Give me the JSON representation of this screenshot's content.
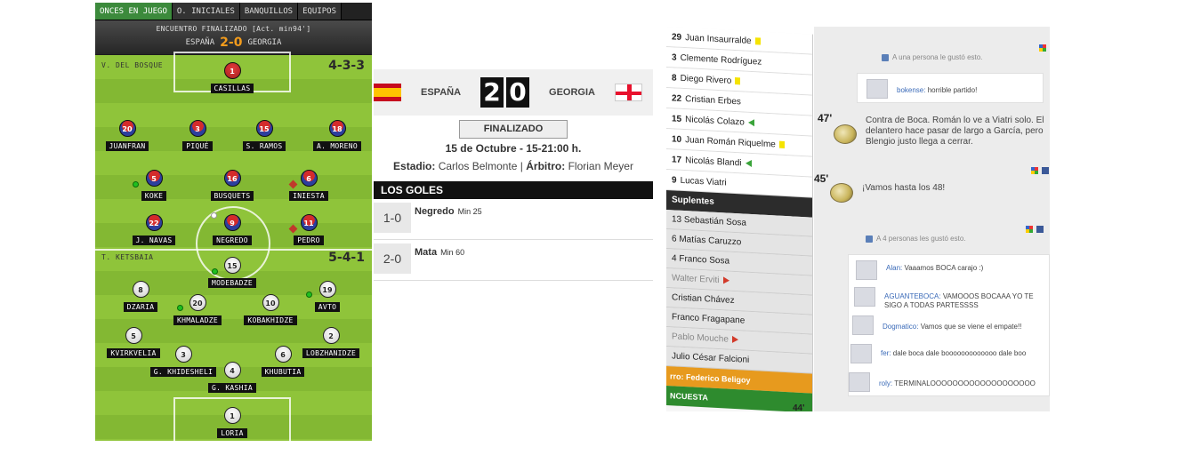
{
  "tabs": [
    "ONCES EN JUEGO",
    "O. INICIALES",
    "BANQUILLOS",
    "EQUIPOS"
  ],
  "match_header": {
    "status": "ENCUENTRO FINALIZADO [Act. min94']",
    "home": "ESPAÑA",
    "score": "2-0",
    "away": "GEORGIA"
  },
  "pitch": {
    "home_coach": "V. DEL BOSQUE",
    "home_formation": "4-3-3",
    "away_coach": "T. KETSBAIA",
    "away_formation": "5-4-1",
    "home_players": [
      {
        "num": "1",
        "name": "CASILLAS"
      },
      {
        "num": "20",
        "name": "JUANFRAN"
      },
      {
        "num": "3",
        "name": "PIQUÉ"
      },
      {
        "num": "15",
        "name": "S. RAMOS"
      },
      {
        "num": "18",
        "name": "A. MORENO"
      },
      {
        "num": "5",
        "name": "KOKE"
      },
      {
        "num": "16",
        "name": "BUSQUETS"
      },
      {
        "num": "6",
        "name": "INIESTA"
      },
      {
        "num": "22",
        "name": "J. NAVAS"
      },
      {
        "num": "9",
        "name": "NEGREDO"
      },
      {
        "num": "11",
        "name": "PEDRO"
      }
    ],
    "away_players": [
      {
        "num": "15",
        "name": "MODEBADZE"
      },
      {
        "num": "8",
        "name": "DZARIA"
      },
      {
        "num": "20",
        "name": "KHMALADZE"
      },
      {
        "num": "10",
        "name": "KOBAKHIDZE"
      },
      {
        "num": "19",
        "name": "AVTO"
      },
      {
        "num": "5",
        "name": "KVIRKVELIA"
      },
      {
        "num": "2",
        "name": "LOBZHANIDZE"
      },
      {
        "num": "3",
        "name": "G. KHIDESHELI"
      },
      {
        "num": "6",
        "name": "KHUBUTIA"
      },
      {
        "num": "4",
        "name": "G. KASHIA"
      },
      {
        "num": "1",
        "name": "LORIA"
      }
    ]
  },
  "scoreboard": {
    "home": "ESPAÑA",
    "away": "GEORGIA",
    "home_goals": "2",
    "away_goals": "0",
    "status_button": "FINALIZADO",
    "date": "15 de Octubre - 15-21:00 h.",
    "stadium_label": "Estadio:",
    "stadium": "Carlos Belmonte",
    "referee_label": "Árbitro:",
    "referee": "Florian Meyer",
    "goals_title": "LOS GOLES",
    "goals": [
      {
        "score": "1-0",
        "player": "Negredo",
        "minute": "Min 25"
      },
      {
        "score": "2-0",
        "player": "Mata",
        "minute": "Min 60"
      }
    ]
  },
  "lineup": {
    "rows": [
      {
        "num": "29",
        "name": "Juan Insaurralde",
        "mark": "yellow"
      },
      {
        "num": "3",
        "name": "Clemente Rodríguez",
        "mark": ""
      },
      {
        "num": "8",
        "name": "Diego Rivero",
        "mark": "yellow"
      },
      {
        "num": "22",
        "name": "Cristian Erbes",
        "mark": ""
      },
      {
        "num": "15",
        "name": "Nicolás Colazo",
        "mark": "in"
      },
      {
        "num": "10",
        "name": "Juan Román Riquelme",
        "mark": "yellow"
      },
      {
        "num": "17",
        "name": "Nicolás Blandi",
        "mark": "in"
      },
      {
        "num": "9",
        "name": "Lucas Viatri",
        "mark": ""
      }
    ],
    "subs_title": "Suplentes",
    "subs": [
      {
        "text": "13 Sebastián Sosa",
        "mark": ""
      },
      {
        "text": "6 Matías Caruzzo",
        "mark": ""
      },
      {
        "text": "4 Franco Sosa",
        "mark": ""
      },
      {
        "text": "Walter Erviti",
        "mark": "out"
      },
      {
        "text": "Cristian Chávez",
        "mark": ""
      },
      {
        "text": "Franco Fragapane",
        "mark": ""
      },
      {
        "text": "Pablo Mouche",
        "mark": "out"
      },
      {
        "text": "Julio César Falcioni",
        "mark": ""
      }
    ],
    "referee_row": "rro: Federico Beligoy",
    "poll_row": "NCUESTA"
  },
  "feed": {
    "like_one": "A una persona le gustó esto.",
    "comment_top": {
      "user": "bokense:",
      "text": "horrible partido!"
    },
    "events": [
      {
        "minute": "47'",
        "text": "Contra de Boca. Román lo ve a Viatri solo. El delantero hace pasar de largo a García, pero Blengio justo llega a cerrar."
      },
      {
        "minute": "45'",
        "text": "¡Vamos hasta los 48!"
      }
    ],
    "like_four": "A 4 personas les gustó esto.",
    "comments": [
      {
        "user": "Alan:",
        "text": "Vaaamos BOCA carajo :)"
      },
      {
        "user": "AGUANTEBOCA:",
        "text": "VAMOOOS BOCAAA YO TE SIGO A TODAS PARTESSSS"
      },
      {
        "user": "Dogmatico:",
        "text": "Vamos que se viene el empate!!"
      },
      {
        "user": "fer:",
        "text": "dale boca dale booooooooooooo dale boo"
      },
      {
        "user": "roly:",
        "text": "TERMINALOOOOOOOOOOOOOOOOOOO"
      }
    ],
    "bottom_minute": "44'"
  }
}
